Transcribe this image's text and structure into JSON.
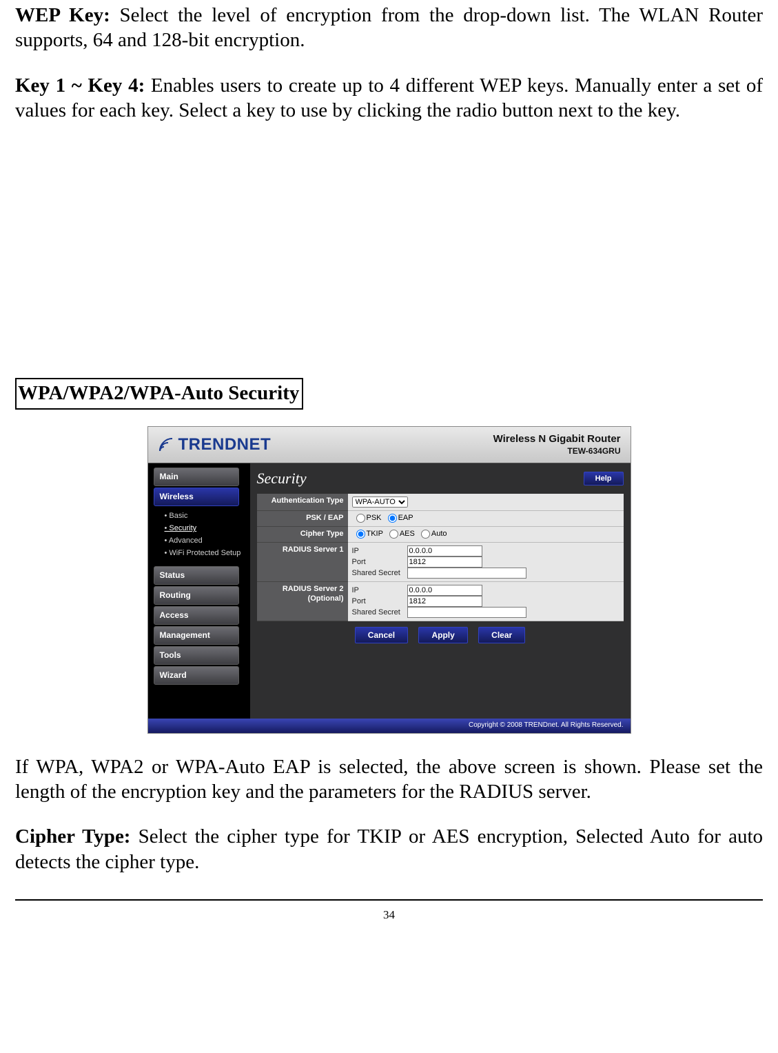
{
  "doc": {
    "wep_key_label": "WEP Key:",
    "wep_key_text": " Select the level of encryption from the drop-down list. The WLAN Router supports, 64 and 128-bit encryption.",
    "keys_label": "Key 1 ~ Key 4:",
    "keys_text": " Enables users to create up to 4 different WEP keys. Manually enter a set of values for each key. Select a key to use by clicking the radio button next to the key.",
    "section_heading": "WPA/WPA2/WPA-Auto Security",
    "after1": "If WPA, WPA2 or WPA-Auto EAP is selected, the above screen is shown.  Please set the length of the encryption key and the parameters for the RADIUS server.",
    "cipher_label": "Cipher Type:",
    "cipher_text": " Select the cipher type for TKIP or AES encryption, Selected Auto for auto detects the cipher type.",
    "page_number": "34"
  },
  "router": {
    "brand": "TRENDNET",
    "title_line1": "Wireless N Gigabit Router",
    "title_line2": "TEW-634GRU",
    "help": "Help",
    "sidebar": {
      "items": [
        {
          "label": "Main"
        },
        {
          "label": "Wireless"
        },
        {
          "label": "Status"
        },
        {
          "label": "Routing"
        },
        {
          "label": "Access"
        },
        {
          "label": "Management"
        },
        {
          "label": "Tools"
        },
        {
          "label": "Wizard"
        }
      ],
      "wireless_sub": [
        {
          "label": "Basic"
        },
        {
          "label": "Security"
        },
        {
          "label": "Advanced"
        },
        {
          "label": "WiFi Protected Setup"
        }
      ]
    },
    "main_title": "Security",
    "form": {
      "auth_label": "Authentication Type",
      "auth_value": "WPA-AUTO",
      "psk_label": "PSK / EAP",
      "psk_opts": [
        "PSK",
        "EAP"
      ],
      "psk_selected": "EAP",
      "cipher_label": "Cipher Type",
      "cipher_opts": [
        "TKIP",
        "AES",
        "Auto"
      ],
      "cipher_selected": "TKIP",
      "r1_label": "RADIUS Server 1",
      "r2_label_a": "RADIUS Server 2",
      "r2_label_b": "(Optional)",
      "ip_label": "IP",
      "port_label": "Port",
      "secret_label": "Shared Secret",
      "r1": {
        "ip": "0.0.0.0",
        "port": "1812",
        "secret": ""
      },
      "r2": {
        "ip": "0.0.0.0",
        "port": "1812",
        "secret": ""
      }
    },
    "buttons": {
      "cancel": "Cancel",
      "apply": "Apply",
      "clear": "Clear"
    },
    "footer": "Copyright © 2008 TRENDnet. All Rights Reserved."
  }
}
